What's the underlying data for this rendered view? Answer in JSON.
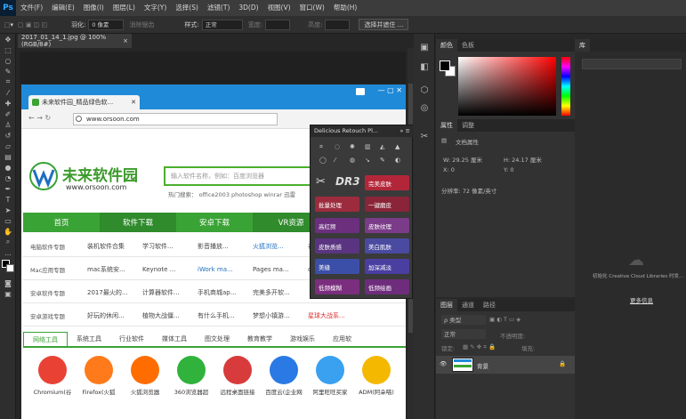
{
  "app": {
    "logo": "Ps"
  },
  "menu": [
    "文件(F)",
    "编辑(E)",
    "图像(I)",
    "图层(L)",
    "文字(Y)",
    "选择(S)",
    "滤镜(T)",
    "3D(D)",
    "视图(V)",
    "窗口(W)",
    "帮助(H)"
  ],
  "options": {
    "feather_label": "羽化:",
    "feather_value": "0 像素",
    "antialias": "消除锯齿",
    "style_label": "样式:",
    "style_value": "正常",
    "width_label": "宽度:",
    "height_label": "高度:",
    "select_mask": "选择并遮住 ..."
  },
  "document": {
    "tab_title": "2017_01_14_1.jpg @ 100%(RGB/8#)",
    "close": "×"
  },
  "browser": {
    "tab_title": "未来软件园_精品绿色软...",
    "address": "www.orsoon.com"
  },
  "site": {
    "name": "未来软件园",
    "url": "www.orsoon.com",
    "search_placeholder": "输入软件名称，例如：百度浏览器",
    "hot_label": "热门搜索：",
    "hot_items": "office2003   photoshop   winrar   迅雷",
    "nav": [
      "首页",
      "软件下载",
      "安卓下载",
      "VR资源",
      ""
    ],
    "rows": [
      {
        "cat": "电脑软件专题",
        "items": [
          "装机软件合集",
          "学习软件...",
          "影音播放...",
          "火狐浏览...",
          "谷歌浏"
        ]
      },
      {
        "cat": "Mac应用专题",
        "items": [
          "mac系统安...",
          "Keynote ...",
          "iWork ma...",
          "Pages ma...",
          "clean"
        ]
      },
      {
        "cat": "安卓软件专题",
        "items": [
          "2017最火的...",
          "计算器软件...",
          "手机商城ap...",
          "完美多开软...",
          ""
        ]
      },
      {
        "cat": "安卓游戏专题",
        "items": [
          "好玩的休闲...",
          "植物大战僵...",
          "有什么手机...",
          "梦想小镇游...",
          "星球大战系..."
        ]
      }
    ],
    "tabs": [
      "网络工具",
      "系统工具",
      "行业软件",
      "媒体工具",
      "图文处理",
      "教育教学",
      "游戏娱乐",
      "应用软"
    ],
    "apps": [
      {
        "name": "Chromium(谷",
        "color": "#e94235"
      },
      {
        "name": "Firefox(火狐",
        "color": "#ff7a1a"
      },
      {
        "name": "火狐浏览器",
        "color": "#ff6d00"
      },
      {
        "name": "360浏览器超",
        "color": "#30b23c"
      },
      {
        "name": "远程桌面链接",
        "color": "#d83b3b"
      },
      {
        "name": "百度云(企业网",
        "color": "#2a79e4"
      },
      {
        "name": "阿里旺旺买家",
        "color": "#3aa0f0"
      },
      {
        "name": "ADM(阿朵喵)",
        "color": "#f5b800"
      }
    ]
  },
  "dr": {
    "title": "Delicious Retouch Pl...",
    "logo": "DR3",
    "perfect_skin": "完美皮肤",
    "batch": "批量处理",
    "one_key": "一键磨皮",
    "buttons": [
      "高红频",
      "皮肤纹理",
      "皮肤质感",
      "美白肌肤",
      "美缝",
      "加深减淡",
      "低频模糊",
      "低频绘画"
    ]
  },
  "color": {
    "tab1": "颜色",
    "tab2": "色板",
    "fg": "#000000",
    "bg": "#ffffff"
  },
  "properties": {
    "tab1": "属性",
    "tab2": "调整",
    "doc_props": "文档属性",
    "w": "W:  29.25 厘米",
    "h": "H:  24.17 厘米",
    "x": "X:  0",
    "y": "Y:  0",
    "resolution": "分辨率: 72 像素/英寸"
  },
  "library": {
    "tab": "库",
    "message": "初始化 Creative Cloud Libraries 时发...",
    "more": "更多信息"
  },
  "layers": {
    "tabs": [
      "图层",
      "通道",
      "路径"
    ],
    "kind": "ρ 类型",
    "mode": "正常",
    "opacity": "不透明度:",
    "lock": "锁定:",
    "fill": "填充:",
    "layer_name": "背景"
  }
}
